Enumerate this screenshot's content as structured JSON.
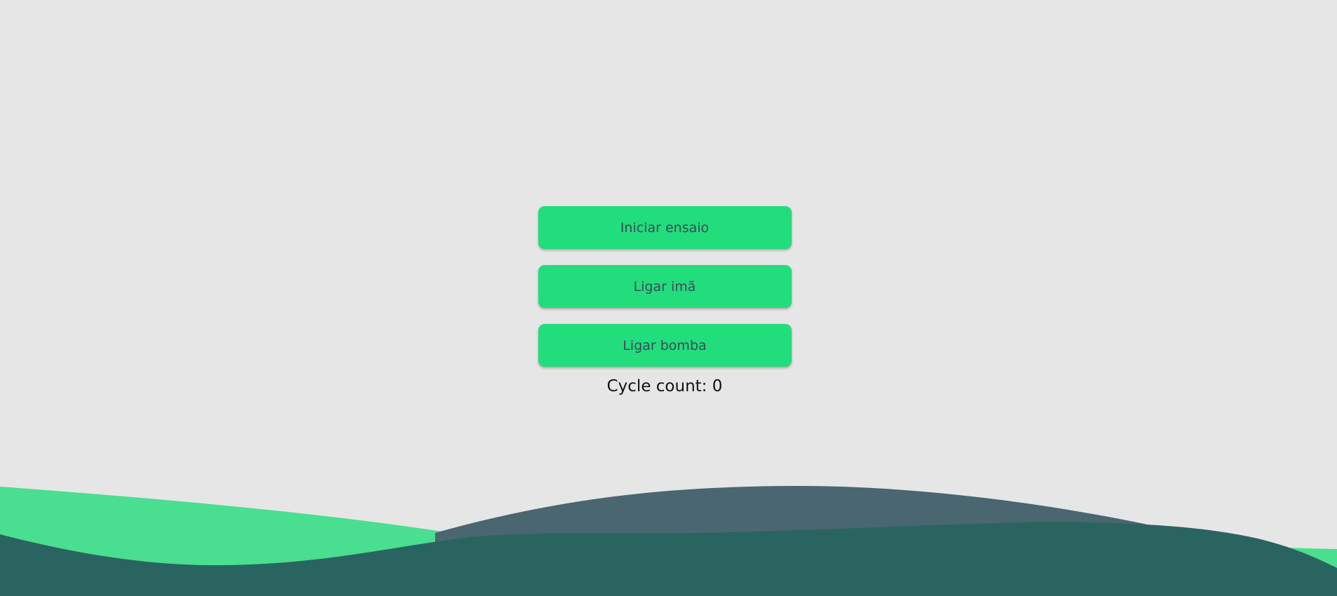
{
  "colors": {
    "background": "#e6e6e6",
    "button_bg": "#21dd7c",
    "button_text": "#3a4a5a",
    "wave_light_green": "#4ade90",
    "wave_slate": "#4a6670",
    "wave_dark_teal": "#2a6460"
  },
  "controls": {
    "buttons": [
      {
        "label": "Iniciar ensaio"
      },
      {
        "label": "Ligar imã"
      },
      {
        "label": "Ligar bomba"
      }
    ],
    "cycle_count": "Cycle count: 0"
  }
}
